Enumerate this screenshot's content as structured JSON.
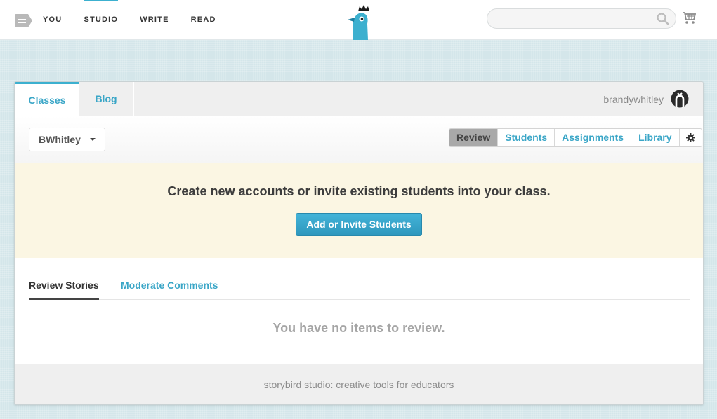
{
  "topnav": {
    "items": [
      "YOU",
      "STUDIO",
      "WRITE",
      "READ"
    ],
    "active_index": 1
  },
  "search": {
    "placeholder": ""
  },
  "panel": {
    "tabs": [
      "Classes",
      "Blog"
    ],
    "active_tab": "Classes",
    "username": "brandywhitley"
  },
  "subbar": {
    "class_selected": "BWhitley",
    "segments": [
      "Review",
      "Students",
      "Assignments",
      "Library"
    ],
    "active_segment": "Review"
  },
  "banner": {
    "text": "Create new accounts or invite existing students into your class.",
    "button_label": "Add or Invite Students"
  },
  "review": {
    "tabs": [
      "Review Stories",
      "Moderate Comments"
    ],
    "active_tab": "Review Stories",
    "empty_message": "You have no items to review."
  },
  "footer": {
    "text": "storybird studio: creative tools for educators"
  },
  "colors": {
    "accent": "#3cb0cf",
    "link": "#3aa6c7",
    "banner_bg": "#fbf6e3",
    "page_bg": "#d4e6ea"
  },
  "icons": [
    "menu-icon",
    "logo-bird",
    "search-icon",
    "cart-icon",
    "avatar-icon",
    "gear-icon",
    "chevron-down-icon"
  ]
}
